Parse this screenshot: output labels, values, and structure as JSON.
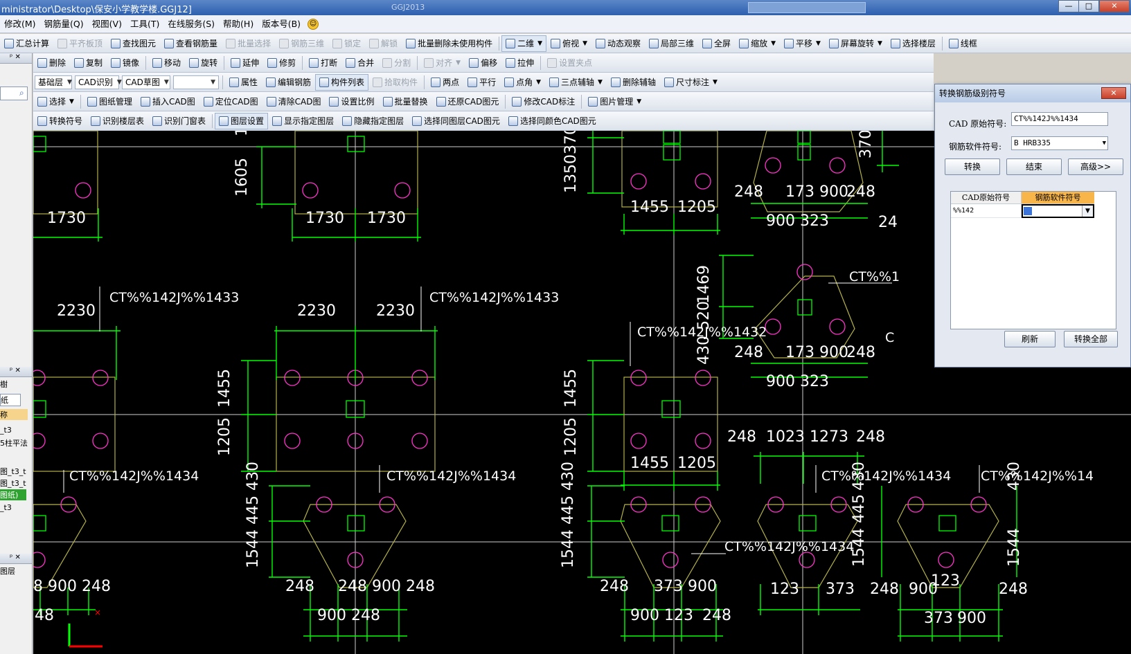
{
  "window": {
    "title": "ministrator\\Desktop\\保安小学教学楼.GGJ12]",
    "ghost_title": "GGJ2013",
    "controls": [
      "—",
      "□",
      "✕"
    ]
  },
  "menubar": {
    "items": [
      "修改(M)",
      "钢筋量(Q)",
      "视图(V)",
      "工具(T)",
      "在线服务(S)",
      "帮助(H)",
      "版本号(B)"
    ]
  },
  "toolbar1": {
    "items": [
      {
        "label": "汇总计算",
        "disabled": false
      },
      {
        "label": "平齐板顶",
        "disabled": true
      },
      {
        "label": "查找图元",
        "disabled": false
      },
      {
        "label": "查看钢筋量",
        "disabled": false
      },
      {
        "label": "批量选择",
        "disabled": true
      },
      {
        "label": "钢筋三维",
        "disabled": true
      },
      {
        "label": "锁定",
        "disabled": true
      },
      {
        "label": "解锁",
        "disabled": true
      },
      {
        "label": "批量删除未使用构件",
        "disabled": false
      },
      {
        "label": "二维",
        "disabled": false,
        "pressed": true,
        "dropdown": true
      },
      {
        "label": "俯视",
        "disabled": false,
        "dropdown": true
      },
      {
        "label": "动态观察",
        "disabled": false
      },
      {
        "label": "局部三维",
        "disabled": false
      },
      {
        "label": "全屏",
        "disabled": false
      },
      {
        "label": "缩放",
        "disabled": false,
        "dropdown": true
      },
      {
        "label": "平移",
        "disabled": false,
        "dropdown": true
      },
      {
        "label": "屏幕旋转",
        "disabled": false,
        "dropdown": true
      },
      {
        "label": "选择楼层",
        "disabled": false
      },
      {
        "label": "线框",
        "disabled": false
      }
    ]
  },
  "toolbar2": {
    "items": [
      {
        "label": "删除",
        "disabled": false
      },
      {
        "label": "复制",
        "disabled": false
      },
      {
        "label": "镜像",
        "disabled": false
      },
      {
        "label": "移动",
        "disabled": false
      },
      {
        "label": "旋转",
        "disabled": false
      },
      {
        "label": "延伸",
        "disabled": false
      },
      {
        "label": "修剪",
        "disabled": false
      },
      {
        "label": "打断",
        "disabled": false
      },
      {
        "label": "合并",
        "disabled": false
      },
      {
        "label": "分割",
        "disabled": true
      },
      {
        "label": "对齐",
        "disabled": true,
        "dropdown": true
      },
      {
        "label": "偏移",
        "disabled": false
      },
      {
        "label": "拉伸",
        "disabled": false
      },
      {
        "label": "设置夹点",
        "disabled": true
      }
    ]
  },
  "toolbar3": {
    "combos": [
      "基础层",
      "CAD识别",
      "CAD草图",
      ""
    ],
    "items": [
      {
        "label": "属性",
        "disabled": false
      },
      {
        "label": "编辑钢筋",
        "disabled": false
      },
      {
        "label": "构件列表",
        "disabled": false,
        "pressed": true
      },
      {
        "label": "拾取构件",
        "disabled": true
      },
      {
        "label": "两点",
        "disabled": false
      },
      {
        "label": "平行",
        "disabled": false
      },
      {
        "label": "点角",
        "disabled": false,
        "dropdown": true
      },
      {
        "label": "三点辅轴",
        "disabled": false,
        "dropdown": true
      },
      {
        "label": "删除辅轴",
        "disabled": false
      },
      {
        "label": "尺寸标注",
        "disabled": false,
        "dropdown": true
      }
    ]
  },
  "toolbar4": {
    "items": [
      {
        "label": "选择",
        "disabled": false,
        "dropdown": true
      },
      {
        "label": "图纸管理",
        "disabled": false
      },
      {
        "label": "插入CAD图",
        "disabled": false
      },
      {
        "label": "定位CAD图",
        "disabled": false
      },
      {
        "label": "清除CAD图",
        "disabled": false
      },
      {
        "label": "设置比例",
        "disabled": false
      },
      {
        "label": "批量替换",
        "disabled": false
      },
      {
        "label": "还原CAD图元",
        "disabled": false
      },
      {
        "label": "修改CAD标注",
        "disabled": false
      },
      {
        "label": "图片管理",
        "disabled": false,
        "dropdown": true
      }
    ]
  },
  "toolbar5": {
    "items": [
      {
        "label": "转换符号",
        "disabled": false
      },
      {
        "label": "识别楼层表",
        "disabled": false
      },
      {
        "label": "识别门窗表",
        "disabled": false
      },
      {
        "label": "图层设置",
        "disabled": false,
        "pressed": true
      },
      {
        "label": "显示指定图层",
        "disabled": false
      },
      {
        "label": "隐藏指定图层",
        "disabled": false
      },
      {
        "label": "选择同图层CAD图元",
        "disabled": false
      },
      {
        "label": "选择同颜色CAD图元",
        "disabled": false
      }
    ]
  },
  "left_panel": {
    "pin_close": "ᵖ ✕",
    "tabs_partial": "樹",
    "paper_label": "纸",
    "name_header": "称",
    "items": [
      "_t3",
      "5柱平法",
      "图_t3_t",
      "图_t3_t",
      "图纸)",
      "_t3"
    ],
    "layer_label": "图层"
  },
  "cad": {
    "dims": [
      "1730",
      "1730",
      "1730",
      "1605",
      "1",
      "2230",
      "2230",
      "2230",
      "1455",
      "1205",
      "1455",
      "1205",
      "1455",
      "1205",
      "1350370",
      "1544 445 430",
      "1544 445 430",
      "1469",
      "520",
      "430",
      "370",
      "248",
      "173 900",
      "248",
      "900 323",
      "248",
      "173 900",
      "248",
      "900 323",
      "248",
      "1023 1273",
      "248",
      "8 900 248",
      "248",
      "248 900 248",
      "900 248",
      "48",
      "248",
      "373 900",
      "900 123",
      "248",
      "123",
      "373",
      "248",
      "900",
      "248",
      "373",
      "900",
      "1544 445",
      "1544",
      "430",
      "430",
      "24",
      "123"
    ],
    "labels": [
      "CT%%142J%%1433",
      "CT%%142J%%1433",
      "CT%%142J%%1432",
      "CT%%142J%%1434",
      "CT%%142J%%1434",
      "CT%%142J%%1434",
      "CT%%142J%%1434",
      "CT%%142J%%14",
      "CT%%1",
      "C"
    ]
  },
  "dialog": {
    "title": "转换钢筋级别符号",
    "close": "✕",
    "cad_label": "CAD 原始符号:",
    "cad_value": "CT%%142J%%1434",
    "soft_label": "钢筋软件符号:",
    "soft_value": "B HRB335",
    "btn_convert": "转换",
    "btn_end": "结束",
    "btn_advanced": "高级>>",
    "grid_h1": "CAD原始符号",
    "grid_h2": "钢筋软件符号",
    "grid_c1": "%%142",
    "btn_refresh": "刷新",
    "btn_convert_all": "转换全部"
  },
  "colors": {
    "canvas": "#000000",
    "dim_green": "#00ff00",
    "outline_yellow": "#b5b24a",
    "circle_magenta": "#ff33cc",
    "crosshair": "#ff0000"
  }
}
